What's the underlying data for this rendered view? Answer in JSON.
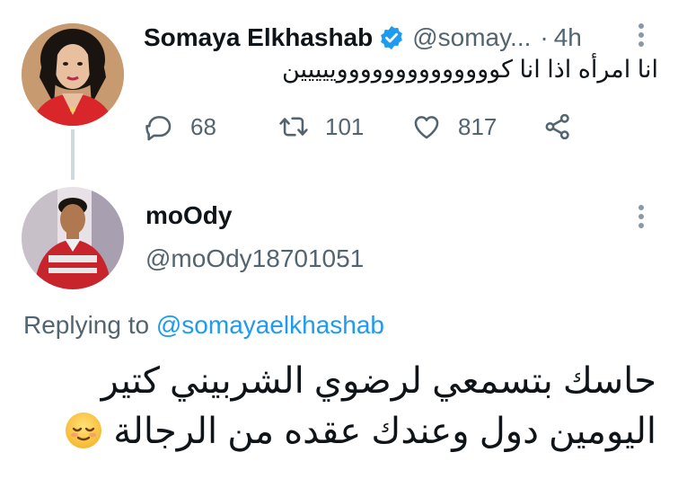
{
  "tweet1": {
    "name": "Somaya Elkhashab",
    "handle": "@somay...",
    "separator": "·",
    "time": "4h",
    "text": "انا امرأه اذا انا كووووووووووووووييييين",
    "stats": {
      "replies": "68",
      "retweets": "101",
      "likes": "817"
    }
  },
  "tweet2": {
    "name": "moOdy",
    "handle": "@moOdy18701051",
    "replying_prefix": "Replying to",
    "replying_to": "@somayaelkhashab",
    "text_line1": "حاسك بتسمعي لرضوي الشربيني كتير",
    "text_line2": "اليومين دول وعندك عقده من الرجالة"
  },
  "icons": [
    "verified-icon",
    "more-icon",
    "reply-icon",
    "retweet-icon",
    "like-icon",
    "share-icon",
    "relieved-face-emoji"
  ],
  "colors": {
    "accent": "#1d9bf0",
    "secondary_text": "#536471",
    "thread_line": "#cfd9de"
  }
}
